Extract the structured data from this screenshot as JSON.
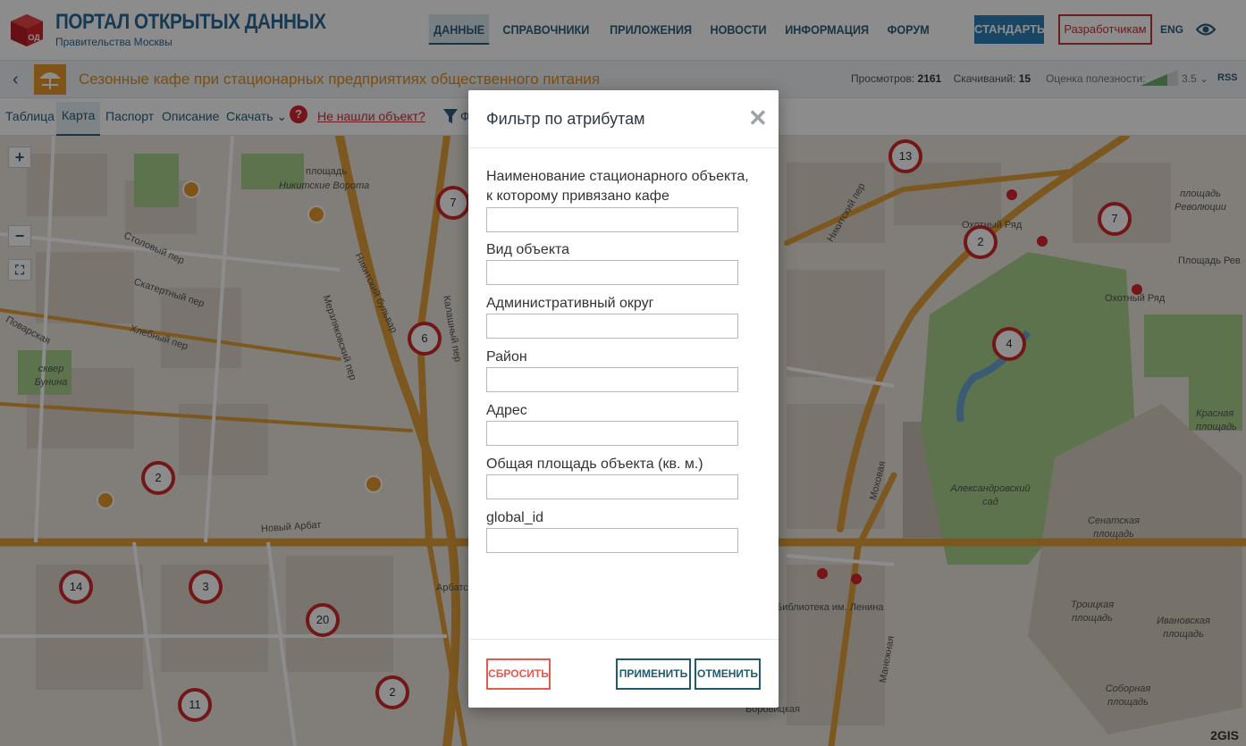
{
  "header": {
    "logo_badge": "ОД",
    "title": "ПОРТАЛ ОТКРЫТЫХ ДАННЫХ",
    "subtitle": "Правительства Москвы",
    "nav": [
      "ДАННЫЕ",
      "СПРАВОЧНИКИ",
      "ПРИЛОЖЕНИЯ",
      "НОВОСТИ",
      "ИНФОРМАЦИЯ",
      "ФОРУМ"
    ],
    "active_nav": "ДАННЫЕ",
    "standards_label": "СТАНДАРТЫ",
    "developers_label": "Разработчикам",
    "lang_label": "ENG"
  },
  "dataset": {
    "title": "Сезонные кафе при стационарных предприятиях общественного питания",
    "views_label": "Просмотров:",
    "views": "2161",
    "downloads_label": "Скачиваний:",
    "downloads": "15",
    "rating_label": "Оценка полезности:",
    "rating_value": "3.5",
    "rss_label": "RSS"
  },
  "tabs": {
    "table": "Таблица",
    "map": "Карта",
    "passport": "Паспорт",
    "description": "Описание",
    "download": "Скачать",
    "help": "?",
    "not_found": "Не нашли объект?",
    "filter_letter": "Ф"
  },
  "map": {
    "clusters": [
      "13",
      "7",
      "7",
      "2",
      "6",
      "4",
      "2",
      "14",
      "3",
      "20",
      "2",
      "11"
    ],
    "streets": [
      "площадь",
      "Никитские Ворота",
      "Столовый пер",
      "Скатертный пер",
      "Хлебный пер",
      "Поварская",
      "Мерзляковский пер",
      "Никитский бульвар",
      "Калашный пер",
      "Новый Арбат",
      "Арбатская",
      "Моховая",
      "Манежная",
      "Никитский пер",
      "Охотный Ряд",
      "Охотный Ряд",
      "площадь Революции",
      "Площадь Рев",
      "Красная площадь",
      "Александровский сад",
      "Сенатская площадь",
      "Троицкая площадь",
      "Ивановская площадь",
      "Соборная площадь",
      "Библиотека им. Ленина",
      "Боровицкая",
      "сквер Бунина"
    ],
    "controls": {
      "zoom_in": "+",
      "zoom_out": "−",
      "fullscreen": "⛶"
    },
    "attribution": "2GIS"
  },
  "modal": {
    "title": "Фильтр по атрибутам",
    "close": "✕",
    "fields": [
      {
        "label": "Наименование стационарного объекта, к которому привязано кафе",
        "value": ""
      },
      {
        "label": "Вид объекта",
        "value": ""
      },
      {
        "label": "Административный округ",
        "value": ""
      },
      {
        "label": "Район",
        "value": ""
      },
      {
        "label": "Адрес",
        "value": ""
      },
      {
        "label": "Общая площадь объекта (кв. м.)",
        "value": ""
      },
      {
        "label": "global_id",
        "value": ""
      }
    ],
    "reset_label": "СБРОСИТЬ",
    "apply_label": "ПРИМЕНИТЬ",
    "cancel_label": "ОТМЕНИТЬ"
  },
  "colors": {
    "brand_blue": "#2a6a9a",
    "accent_red": "#c7333b",
    "dataset_orange": "#e48d1a",
    "road_orange": "#e2a13b"
  }
}
